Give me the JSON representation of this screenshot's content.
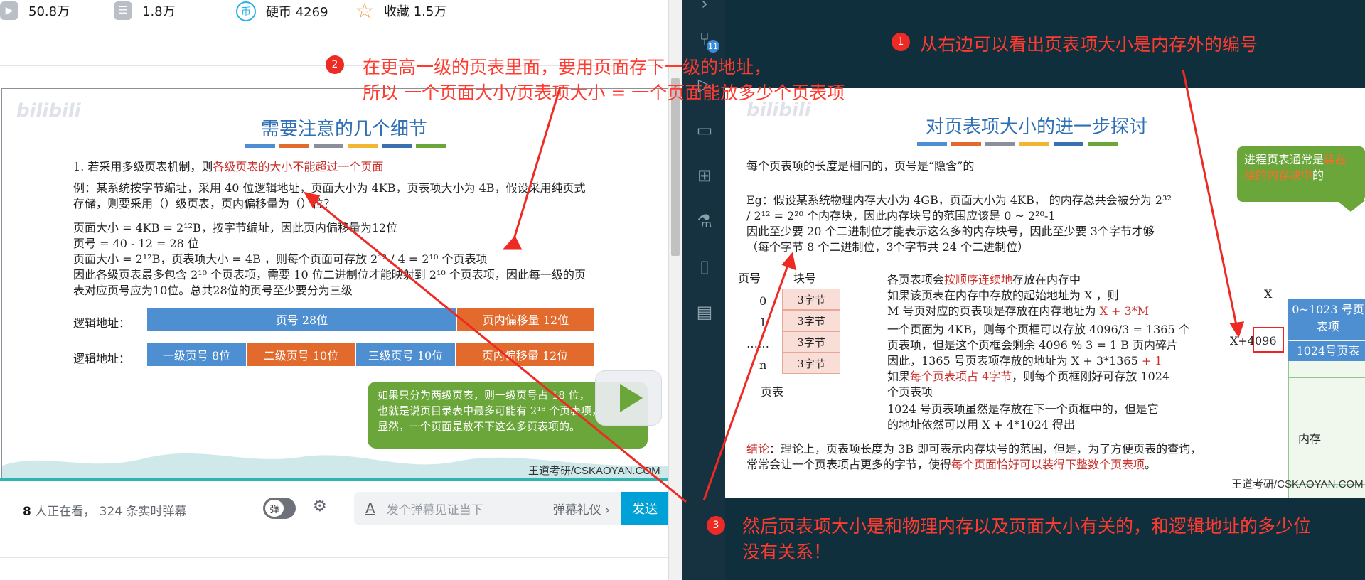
{
  "stats": {
    "views": "50.8万",
    "danmaku": "1.8万",
    "coins": "硬币 4269",
    "favorites": "收藏 1.5万"
  },
  "left_slide": {
    "logo": "bilibili",
    "title": "需要注意的几个细节",
    "color_bars": [
      "#4e8fd2",
      "#e36a2d",
      "#8a8f99",
      "#f2b632",
      "#3a6fb0",
      "#6aa63a"
    ],
    "point1_prefix": "1. 若采用多级页表机制，则",
    "point1_red": "各级页表的大小不能超过一个页面",
    "example_l1": "例：某系统按字节编址，采用 40 位逻辑地址，页面大小为 4KB，页表项大小为 4B，假设采用纯页式",
    "example_l2": "存储，则要采用（）级页表，页内偏移量为（）位？",
    "calc_l1": "页面大小 = 4KB = 2¹²B，按字节编址，因此页内偏移量为12位",
    "calc_l2": "页号 = 40 - 12 = 28 位",
    "calc_l3": "页面大小 = 2¹²B，页表项大小 = 4B ，则每个页面可存放 2¹² / 4 = 2¹⁰ 个页表项",
    "calc_l4": "因此各级页表最多包含 2¹⁰ 个页表项，需要 10 位二进制位才能映射到 2¹⁰ 个页表项，因此每一级的页",
    "calc_l5": "表对应页号应为10位。总共28位的页号至少要分为三级",
    "addr_label_1": "逻辑地址：",
    "addr_label_2": "逻辑地址：",
    "bar1": [
      "页号  28位",
      "页内偏移量 12位"
    ],
    "bar2": [
      "一级页号 8位",
      "二级页号 10位",
      "三级页号 10位",
      "页内偏移量 12位"
    ],
    "callout_l1": "如果只分为两级页表，则一级页号占 18 位，",
    "callout_l2": "也就是说页目录表中最多可能有 2¹⁸ 个页表项，",
    "callout_l3": "显然，一个页面是放不下这么多页表项的。",
    "watermark": "王道考研/CSKAOYAN.COM"
  },
  "danmaku": {
    "watching_count": "8",
    "watching_text": " 人正在看，  324 条实时弹幕",
    "toggle_label": "弹",
    "input_placeholder": "发个弹幕见证当下",
    "etiquette": "弹幕礼仪 ›",
    "send": "发送"
  },
  "right_slide": {
    "logo": "bilibili",
    "title": "对页表项大小的进一步探讨",
    "subtitle": "每个页表项的长度是相同的，页号是“隐含”的",
    "eg_l1": "Eg：假设某系统物理内存大小为 4GB，页面大小为 4KB， 的内存总共会被分为 2³²",
    "eg_l2": "/ 2¹² = 2²⁰ 个内存块，因此内存块号的范围应该是 0 ~ 2²⁰-1",
    "eg_l3": "因此至少要 20 个二进制位才能表示这么多的内存块号，因此至少要 3个字节才够",
    "eg_l4": "（每个字节 8 个二进制位，3个字节共 24 个二进制位）",
    "table_hdr_page": "页号",
    "table_hdr_block": "块号",
    "table_rows": [
      {
        "page": "0",
        "block": "3字节"
      },
      {
        "page": "1",
        "block": "3字节"
      },
      {
        "page": "……",
        "block": "3字节"
      },
      {
        "page": "n",
        "block": "3字节"
      }
    ],
    "table_caption": "页表",
    "r_l1_a": "各页表项会",
    "r_l1_red": "按顺序连续地",
    "r_l1_b": "存放在内存中",
    "r_l2": "如果该页表在内存中存放的起始地址为 X ，则",
    "r_l3_a": "M 号页对应的页表项是存放在内存地址为 ",
    "r_l3_red": "X + 3*M",
    "r_l4": "一个页面为 4KB，则每个页框可以存放 4096/3 = 1365 个",
    "r_l5": "页表项，但是这个页框会剩余 4096 % 3 = 1 B 页内碎片",
    "r_l6_a": "因此，1365 号页表项存放的地址为 X + 3*1365 ",
    "r_l6_red": "+ 1",
    "r_l7_a": "如果",
    "r_l7_red": "每个页表项占 4字节",
    "r_l7_b": "，则每个页框刚好可存放 1024",
    "r_l8": "个页表项",
    "r_l9": "1024 号页表项虽然是存放在下一个页框中的，但是它",
    "r_l10": "的地址依然可以用 X + 4*1024 得出",
    "concl_label": "结论",
    "concl_l1": "：理论上，页表项长度为 3B 即可表示内存块号的范围，但是，为了方便页表的查询，",
    "concl_l2_a": "常常会让一个页表项占更多的字节，使得",
    "concl_l2_red": "每个页面恰好可以装得下整数个页表项",
    "concl_l2_b": "。",
    "note_l1_a": "进程页表通常是",
    "note_l1_red": "装在",
    "note_l2_red": "续的内存块中",
    "note_l2_b": "的",
    "label_x": "X",
    "label_x4096": "X+4096",
    "mem_block1": "0~1023 号页",
    "mem_block1b": "表项",
    "mem_block2": "1024号页表",
    "mem_caption": "内存",
    "watermark": "王道考研/CSKAOYAN.COM"
  },
  "annotations": {
    "a1_num": "1",
    "a1_text": "从右边可以看出页表项大小是内存外的编号",
    "a2_num": "2",
    "a2_l1": "在更高一级的页表里面，要用页面存下一级的地址，",
    "a2_l2": "所以  一个页面大小/页表项大小  =  一个页面能放多少个页表项",
    "a3_num": "3",
    "a3_l1": "然后页表项大小是和物理内存以及页面大小有关的，和逻辑地址的多少位",
    "a3_l2": "没有关系！"
  },
  "colors": {
    "annotation_red": "#ff3b30",
    "slide_blue": "#2e6fb5",
    "bili_cyan": "#00a1d6",
    "editor_bg": "#0f2f3d"
  }
}
